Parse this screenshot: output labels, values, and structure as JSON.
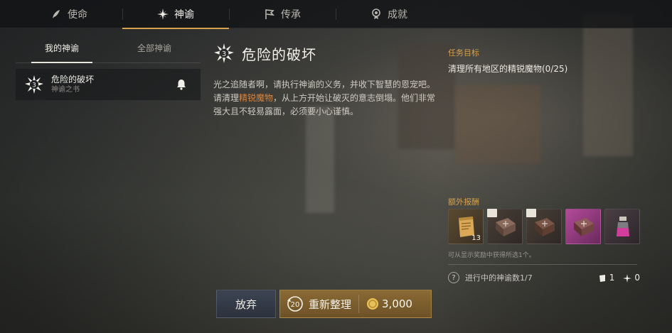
{
  "tabs": [
    {
      "label": "使命",
      "icon": "quill-icon"
    },
    {
      "label": "神谕",
      "icon": "starburst-icon"
    },
    {
      "label": "传承",
      "icon": "flag-icon"
    },
    {
      "label": "成就",
      "icon": "medal-icon"
    }
  ],
  "active_tab": "神谕",
  "left": {
    "subtabs": [
      "我的神谕",
      "全部神谕"
    ],
    "quest": {
      "badge_number": "3",
      "title": "危险的破坏",
      "subtitle": "神谕之书"
    }
  },
  "detail": {
    "badge_number": "3",
    "title": "危险的破坏",
    "desc_part1": "光之追随者啊，请执行神谕的义务，并收下智慧的恩宠吧。请清理",
    "desc_highlight": "精锐魔物",
    "desc_part2": "，从上方开始让破灭的意志倒塌。他们非常强大且不轻易露面，必须要小心谨慎。"
  },
  "objective": {
    "label": "任务目标",
    "text": "清理所有地区的精锐魔物(0/25)"
  },
  "rewards": {
    "label": "额外报酬",
    "items": [
      {
        "icon": "scroll-icon",
        "count": "13",
        "tagged": false
      },
      {
        "icon": "book-icon",
        "count": "",
        "tagged": true
      },
      {
        "icon": "book-icon",
        "count": "",
        "tagged": true
      },
      {
        "icon": "book-icon",
        "count": "",
        "tagged": false
      },
      {
        "icon": "potion-icon",
        "count": "",
        "tagged": false
      }
    ],
    "note": "可从显示奖励中获得所选1个。"
  },
  "progress": {
    "text": "进行中的神谕数1/7",
    "count1": "1",
    "count2": "0"
  },
  "buttons": {
    "abandon": "放弃",
    "reroll_circle": "20",
    "reroll": "重新整理",
    "cost": "3,000"
  },
  "colors": {
    "accent": "#d7a14a",
    "highlight": "#d9853d"
  }
}
